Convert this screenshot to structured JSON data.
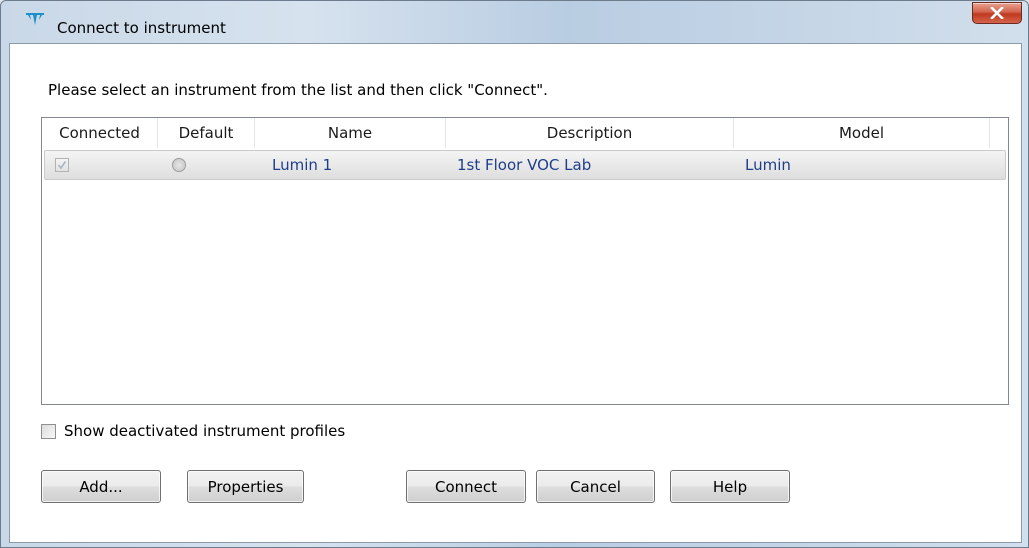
{
  "window": {
    "title": "Connect to instrument"
  },
  "instructions": "Please select an instrument from the list and then click \"Connect\".",
  "table": {
    "columns": [
      "Connected",
      "Default",
      "Name",
      "Description",
      "Model"
    ],
    "rows": [
      {
        "connected": true,
        "default": false,
        "name": "Lumin 1",
        "description": "1st Floor VOC Lab",
        "model": "Lumin"
      }
    ]
  },
  "options": {
    "show_deactivated_label": "Show deactivated instrument profiles",
    "show_deactivated_checked": false
  },
  "buttons": {
    "add": "Add...",
    "properties": "Properties",
    "connect": "Connect",
    "cancel": "Cancel",
    "help": "Help"
  },
  "colors": {
    "row_text": "#1f3e8a",
    "close_button": "#c0391f",
    "app_icon": "#1d8fc9"
  }
}
